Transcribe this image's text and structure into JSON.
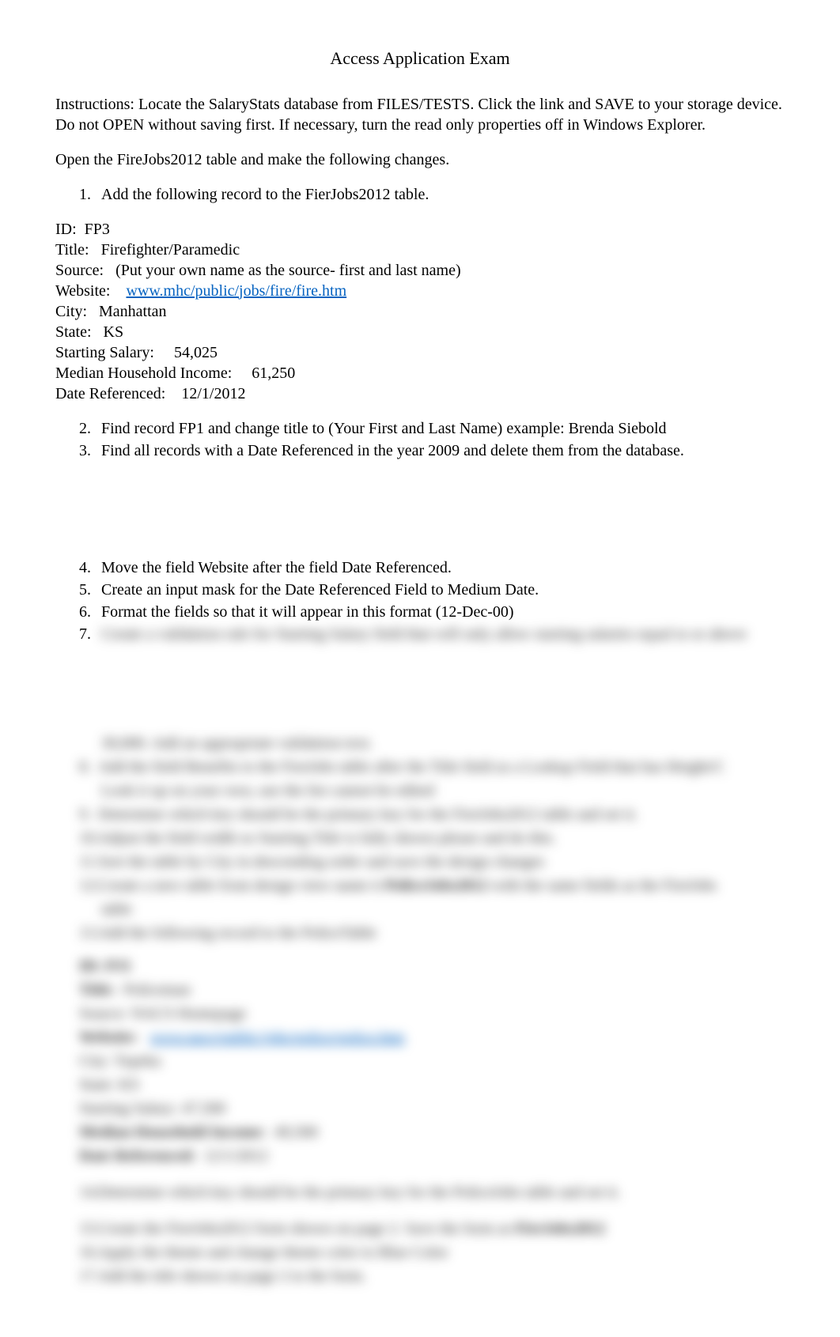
{
  "title": "Access Application Exam",
  "instructions": "Instructions:   Locate the SalaryStats database from FILES/TESTS.   Click the link and SAVE to your storage device.  Do not OPEN without saving first.  If necessary, turn the read only properties off in Windows Explorer.",
  "open_line": "Open the FireJobs2012 table   and make the following changes.",
  "items": {
    "i1_num": "1.",
    "i1": "Add the following record to the FierJobs2012 table.",
    "i2_num": "2.",
    "i2": "Find record FP1 and change title to (Your First and Last Name) example: Brenda Siebold",
    "i3_num": "3.",
    "i3": "Find all records with a Date Referenced in the year 2009 and delete them from the database.",
    "i4_num": "4.",
    "i4": "Move the field Website after the field Date Referenced.",
    "i5_num": "5.",
    "i5": "Create an input mask for the Date Referenced Field to Medium Date.",
    "i6_num": "6.",
    "i6": "Format the fields so that it will appear in this format   (12-Dec-00)",
    "i7_num": "7."
  },
  "record": {
    "id_label": "ID:",
    "id": "FP3",
    "title_label": "Title:",
    "title": "Firefighter/Paramedic",
    "source_label": "Source:",
    "source": "(Put your own name as the source- first and last name)",
    "website_label": "Website:",
    "website": "www.mhc/public/jobs/fire/fire.htm",
    "city_label": "City:",
    "city": "Manhattan",
    "state_label": "State:",
    "state": "KS",
    "salary_label": "Starting Salary:",
    "salary": "54,025",
    "income_label": "Median Household Income:",
    "income": "61,250",
    "date_label": "Date Referenced:",
    "date": "12/1/2012"
  },
  "blurred": {
    "b7": "Create a validation rule for Starting Salary field that will only allow starting salaries equal to or above",
    "b_sub": "30,000.    Add an appropriate validation text.",
    "b8n": "8.",
    "b8": "Add the field Benefits to the FireJobs table after the Title field as a Lookup Field that has Height/C",
    "b8b": "Look it up on your own, use the list cannot be edited",
    "b9n": "9.",
    "b9": "Determine which key should be the primary key for the FireJobs2012 table and set it.",
    "b10n": "10.",
    "b10": "Adjust the field width so Starting Title is fully shown please and do this.",
    "b11n": "11.",
    "b11": "Sort the table by City in descending order and save the design changes",
    "b12n": "12.",
    "b12a": "Create a new table from design view name it ",
    "b12b": "PoliceJobs2012",
    "b12c": " with the same fields as the FireJobs",
    "b12d": "table",
    "b13n": "13.",
    "b13": "Add the following record to the PoliceTable",
    "r_id": "ID: PJ1",
    "r_titleL": "Title:",
    "r_title": "Policeman",
    "r_src": "Source:  NACS Homepage",
    "r_webL": "Website:",
    "r_web": "www.nacs/public/jobs/police/police.htm",
    "r_city": "City:   Topeka",
    "r_state": "State:  KS",
    "r_sal": "Starting Salary:    47,500",
    "r_incL": "Median Household Income:",
    "r_inc": "49,500",
    "r_dateL": "Date Referenced:",
    "r_date": "12/1/2012",
    "b14n": "14.",
    "b14": "Determine which key should be the primary key for the PoliceJobs table and set it.",
    "b15n": "15.",
    "b15a": "Create the FireJobs2012 form shown on page 2.    Save the form as ",
    "b15b": "FireJobs2012",
    "b16n": "16.",
    "b16": "Apply the theme and change theme color to Blue Color",
    "b17n": "17.",
    "b17": "Add the title shown on page 2 to the form."
  }
}
